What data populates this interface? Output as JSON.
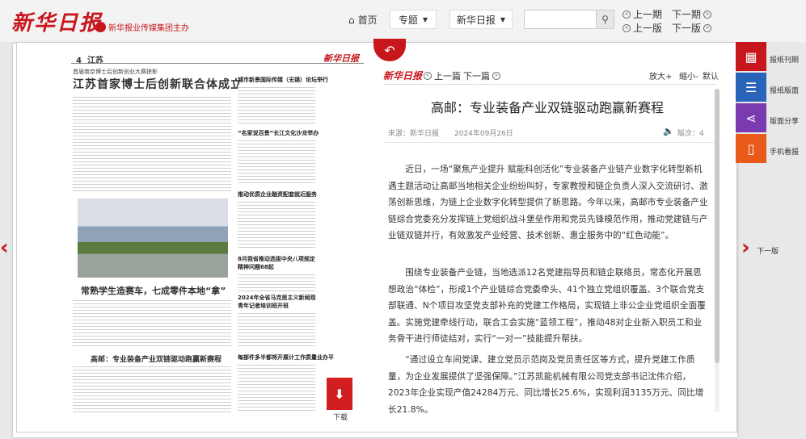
{
  "header": {
    "logo": "新华日报",
    "sublogo": "新华报业传媒集团主办",
    "home": "首页",
    "topic": "专题",
    "paper": "新华日报",
    "prev_issue": "上一期",
    "next_issue": "下一期",
    "prev_page": "上一版",
    "next_page": "下一版"
  },
  "newspaper": {
    "page_label": "4",
    "section": "江苏",
    "brand": "新华日报",
    "kicker": "首届南京博士后创新创业大赛掠影",
    "title1": "江苏首家博士后创新联合体成立",
    "title2": "常熟学生造赛车，七成零件本地“拿”",
    "title3": "高邮：专业装备产业双链驱动跑赢新赛程",
    "side1": "城市新景国际传媒（无锡）论坛举行",
    "side2": "“名家说百景”长江文化沙龙举办",
    "side3": "推动优质企业融资配套就近服务",
    "side4": "8月我省推动选拔中央八项规定精神问题68起",
    "side5": "2024年全省马克思主义新闻观青年记者培训班开班",
    "side6": "每部件多半都将开展计工作质量业办平",
    "download": "下载"
  },
  "article": {
    "brand": "新华日报",
    "prev": "上一篇",
    "next": "下一篇",
    "zoom_in": "放大+",
    "zoom_out": "缩小-",
    "default": "默认",
    "title": "高邮：专业装备产业双链驱动跑赢新赛程",
    "source": "来源：新华日报",
    "date": "2024年09月26日",
    "page": "版次：4",
    "p1": "近日，一场“聚焦产业提升 赋能科创活化”专业装备产业链产业数字化转型新机遇主题活动让高邮当地相关企业纷纷叫好，专家教授和链企负责人深入交流研讨、激荡创新思维，为链上企业数字化转型提供了新思路。今年以来，高邮市专业装备产业链综合党委充分发挥链上党组织战斗堡垒作用和党员先锋模范作用，推动党建链与产业链双链并行，有效激发产业经营、技术创新、惠企服务中的“红色动能”。",
    "p2": "围绕专业装备产业链，当地选派12名党建指导员和链企联络员，常态化开展思想政治“体检”，形成1个产业链综合党委牵头、41个独立党组织覆盖、3个联合党支部联通、N个项目攻坚党支部补充的党建工作格局，实现链上非公企业党组织全面覆盖。实施党建牵线行动，联合工会实施“蓝领工程”，推动48对企业新入职员工和业务骨干进行师徒结对，实行“一对一”技能提升帮扶。",
    "p3": "“通过设立车间党课、建立党员示范岗及党员责任区等方式，提升党建工作质量，为企业发展提供了坚强保障。”江苏凯能机械有限公司党支部书记沈伟介绍，2023年企业实现产值24284万元、同比增长25.6%，实现利润3135万元、同比增长21.8%。"
  },
  "sidebar": {
    "calendar": "报纸刊期",
    "list": "报纸版面",
    "share": "版面分享",
    "mobile": "手机看报",
    "next_page": "下一版"
  },
  "colors": {
    "accent": "#c8161d",
    "blue": "#2a64b8",
    "purple": "#7a3bb0",
    "orange": "#e85a1a"
  }
}
